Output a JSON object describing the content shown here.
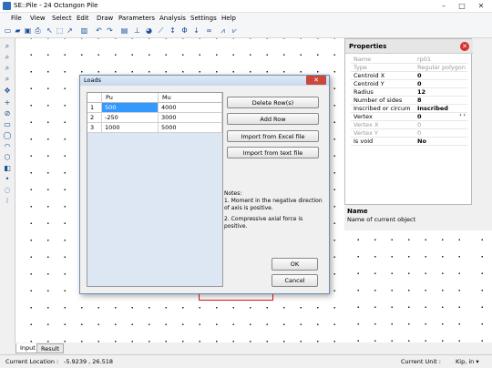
{
  "window": {
    "title": "SE::Pile - 24 Octangon Pile",
    "min": "–",
    "max": "□",
    "close": "✕"
  },
  "menu": [
    "File",
    "View",
    "Select",
    "Edit",
    "Draw",
    "Parameters",
    "Analysis",
    "Settings",
    "Help"
  ],
  "properties": {
    "header": "Properties",
    "rows": [
      {
        "k": "Name",
        "v": "rp01",
        "gray": true
      },
      {
        "k": "Type",
        "v": "Regular polygon",
        "gray": true
      },
      {
        "k": "Centroid  X",
        "v": "0"
      },
      {
        "k": "Centroid  Y",
        "v": "0"
      },
      {
        "k": "Radius",
        "v": "12"
      },
      {
        "k": "Number of sides",
        "v": "8"
      },
      {
        "k": "Inscribed or circumscribed",
        "v": "Inscribed"
      },
      {
        "k": "Vertex",
        "v": "0"
      },
      {
        "k": "Vertex X",
        "v": "0",
        "gray": true
      },
      {
        "k": "Vertex Y",
        "v": "0",
        "gray": true
      },
      {
        "k": "Is void",
        "v": "No"
      }
    ],
    "desc_name": "Name",
    "desc_text": "Name of current object"
  },
  "dialog": {
    "title": "Loads",
    "columns": [
      "Pu",
      "Mu"
    ],
    "rows": [
      {
        "n": "1",
        "pu": "500",
        "mu": "4000"
      },
      {
        "n": "2",
        "pu": "-250",
        "mu": "3000"
      },
      {
        "n": "3",
        "pu": "1000",
        "mu": "5000"
      }
    ],
    "buttons": {
      "delete": "Delete Row(s)",
      "add": "Add Row",
      "excel": "Import from Excel file",
      "text": "Import from text file",
      "ok": "OK",
      "cancel": "Cancel"
    },
    "notes": [
      "Notes:",
      "1. Moment in the negative direction of axis is positive.",
      "2. Compressive axial force is positive."
    ]
  },
  "tabs": [
    "Input",
    "Result"
  ],
  "status": {
    "location_label": "Current Location :",
    "location": "-5.9239 , 26.518",
    "unit_label": "Current Unit :",
    "unit": "Kip, in ▾"
  }
}
